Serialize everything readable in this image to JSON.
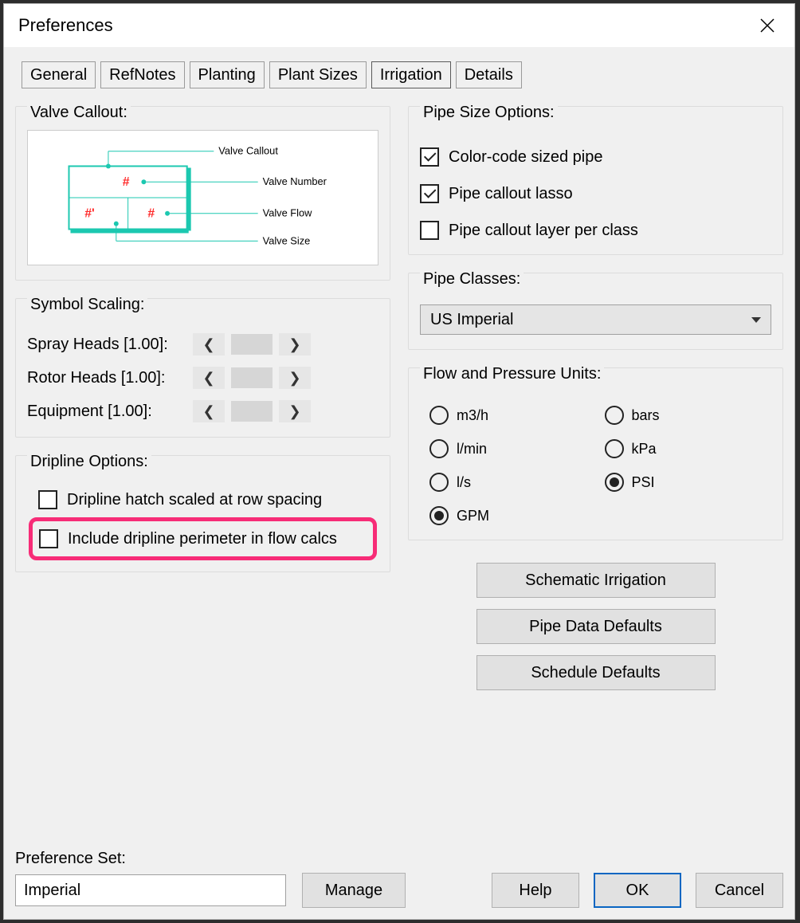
{
  "window": {
    "title": "Preferences"
  },
  "tabs": [
    "General",
    "RefNotes",
    "Planting",
    "Plant Sizes",
    "Irrigation",
    "Details"
  ],
  "active_tab_index": 4,
  "valve_callout": {
    "title": "Valve Callout:",
    "labels": {
      "top": "Valve Callout",
      "number": "Valve Number",
      "flow": "Valve Flow",
      "size": "Valve Size"
    }
  },
  "symbol_scaling": {
    "title": "Symbol Scaling:",
    "rows": [
      {
        "label": "Spray Heads [1.00]:"
      },
      {
        "label": "Rotor Heads [1.00]:"
      },
      {
        "label": "Equipment [1.00]:"
      }
    ]
  },
  "dripline": {
    "title": "Dripline Options:",
    "opt1": "Dripline hatch scaled at row spacing",
    "opt2": "Include dripline perimeter in flow calcs"
  },
  "pipe_size_options": {
    "title": "Pipe Size Options:",
    "opt1": "Color-code sized pipe",
    "opt2": "Pipe callout lasso",
    "opt3": "Pipe callout layer per class"
  },
  "pipe_classes": {
    "title": "Pipe Classes:",
    "selected": "US Imperial"
  },
  "flow_pressure": {
    "title": "Flow and Pressure Units:",
    "flow": [
      "m3/h",
      "l/min",
      "l/s",
      "GPM"
    ],
    "pressure": [
      "bars",
      "kPa",
      "PSI"
    ],
    "flow_selected": "GPM",
    "pressure_selected": "PSI"
  },
  "buttons": {
    "schematic": "Schematic Irrigation",
    "pipe_data": "Pipe Data Defaults",
    "schedule": "Schedule Defaults"
  },
  "pref_set": {
    "label": "Preference Set:",
    "selected": "Imperial",
    "manage": "Manage"
  },
  "footer": {
    "help": "Help",
    "ok": "OK",
    "cancel": "Cancel"
  }
}
